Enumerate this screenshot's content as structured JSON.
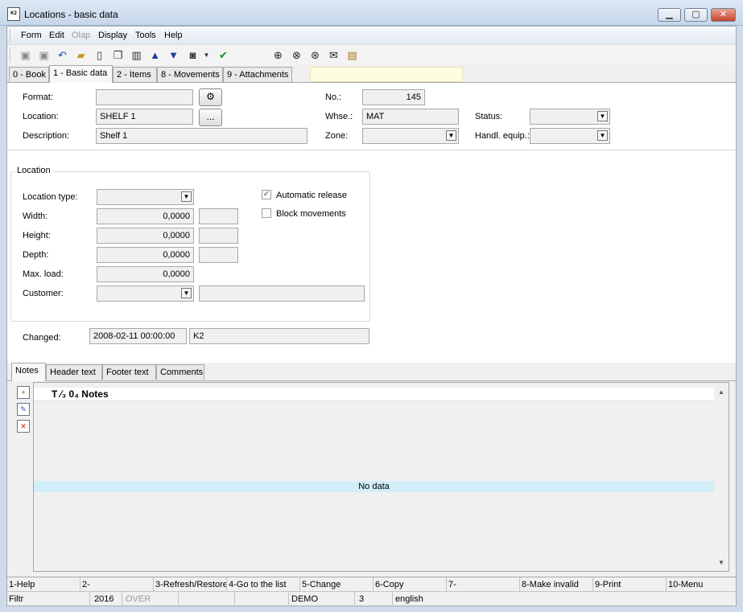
{
  "window": {
    "title": "Locations - basic data",
    "icon_label": "K2",
    "controls": [
      "minimize-icon",
      "maximize-icon",
      "close-icon"
    ]
  },
  "menu": {
    "items": [
      {
        "label": "Form",
        "enabled": true
      },
      {
        "label": "Edit",
        "enabled": true
      },
      {
        "label": "Olap",
        "enabled": false
      },
      {
        "label": "Display",
        "enabled": true
      },
      {
        "label": "Tools",
        "enabled": true
      },
      {
        "label": "Help",
        "enabled": true
      }
    ]
  },
  "toolbar": {
    "icons": [
      "save-icon",
      "save-as-icon",
      "undo-icon",
      "open-folder-icon",
      "new-document-icon",
      "copy-document-icon",
      "book-icon",
      "arrow-up-icon",
      "arrow-down-icon",
      "camera-icon",
      "dropdown-arrow-icon",
      "filter-check-icon",
      "binoculars-icon",
      "binoculars-next-icon",
      "binoculars-filter-icon",
      "envelope-icon",
      "notepad-icon"
    ]
  },
  "tabs_top": [
    {
      "label": "0 - Book",
      "active": false
    },
    {
      "label": "1 - Basic data",
      "active": true
    },
    {
      "label": "2 - Items",
      "active": false
    },
    {
      "label": "8 - Movements",
      "active": false
    },
    {
      "label": "9 - Attachments",
      "active": false
    }
  ],
  "form": {
    "format_label": "Format:",
    "format_value": "",
    "location_label": "Location:",
    "location_value": "SHELF 1",
    "location_browse": "...",
    "description_label": "Description:",
    "description_value": "Shelf 1",
    "no_label": "No.:",
    "no_value": "145",
    "whse_label": "Whse.:",
    "whse_value": "MAT",
    "zone_label": "Zone:",
    "zone_value": "",
    "status_label": "Status:",
    "status_value": "",
    "handl_label": "Handl. equip.:",
    "handl_value": ""
  },
  "location_group": {
    "title": "Location",
    "type_label": "Location type:",
    "type_value": "",
    "width_label": "Width:",
    "width_value": "0,0000",
    "height_label": "Height:",
    "height_value": "0,0000",
    "depth_label": "Depth:",
    "depth_value": "0,0000",
    "maxload_label": "Max. load:",
    "maxload_value": "0,0000",
    "customer_label": "Customer:",
    "customer_value": "",
    "auto_release_label": "Automatic release",
    "auto_release_checked": true,
    "block_label": "Block movements",
    "block_checked": false
  },
  "changed": {
    "label": "Changed:",
    "date": "2008-02-11 00:00:00",
    "user": "K2"
  },
  "tabs_bottom": [
    {
      "label": "Notes",
      "active": true
    },
    {
      "label": "Header text",
      "active": false
    },
    {
      "label": "Footer text",
      "active": false
    },
    {
      "label": "Comments",
      "active": false
    }
  ],
  "notes_grid": {
    "column_prefix": "T ⁄₃ 0₄",
    "column_header": "Notes",
    "empty_text": "No data",
    "side_icons": [
      "add-note-icon",
      "edit-note-icon",
      "delete-note-icon"
    ]
  },
  "function_keys": [
    "1-Help",
    "2-",
    "3-Refresh/Restore",
    "4-Go to the list",
    "5-Change",
    "6-Copy",
    "7-",
    "8-Make invalid",
    "9-Print",
    "10-Menu"
  ],
  "statusbar": {
    "filter": "Filtr",
    "year": "2016",
    "mode": "OVER",
    "empty1": "",
    "empty2": "",
    "database": "DEMO",
    "number": "3",
    "language": "english"
  }
}
